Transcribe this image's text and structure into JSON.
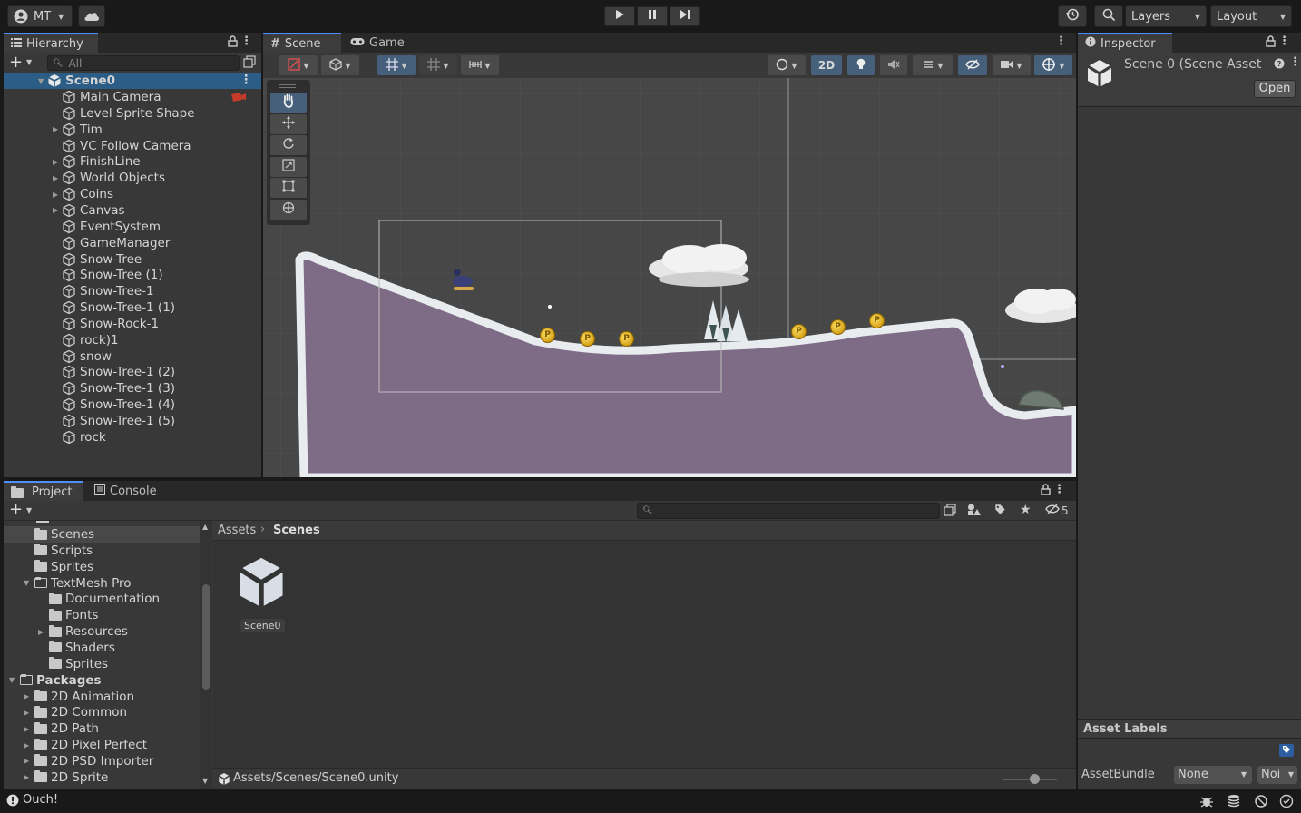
{
  "toolbar": {
    "account_label": "MT",
    "layers_label": "Layers",
    "layout_label": "Layout"
  },
  "hierarchy": {
    "tab_label": "Hierarchy",
    "search_placeholder": "All",
    "scene_name": "Scene0",
    "items": [
      {
        "label": "Main Camera",
        "expandable": false
      },
      {
        "label": "Level Sprite Shape",
        "expandable": false
      },
      {
        "label": "Tim",
        "expandable": true
      },
      {
        "label": "VC Follow Camera",
        "expandable": false
      },
      {
        "label": "FinishLine",
        "expandable": true
      },
      {
        "label": "World Objects",
        "expandable": true
      },
      {
        "label": "Coins",
        "expandable": true
      },
      {
        "label": "Canvas",
        "expandable": true
      },
      {
        "label": "EventSystem",
        "expandable": false
      },
      {
        "label": "GameManager",
        "expandable": false
      },
      {
        "label": "Snow-Tree",
        "expandable": false
      },
      {
        "label": "Snow-Tree (1)",
        "expandable": false
      },
      {
        "label": "Snow-Tree-1",
        "expandable": false
      },
      {
        "label": "Snow-Tree-1 (1)",
        "expandable": false
      },
      {
        "label": "Snow-Rock-1",
        "expandable": false
      },
      {
        "label": "rock)1",
        "expandable": false
      },
      {
        "label": "snow",
        "expandable": false
      },
      {
        "label": "Snow-Tree-1 (2)",
        "expandable": false
      },
      {
        "label": "Snow-Tree-1 (3)",
        "expandable": false
      },
      {
        "label": "Snow-Tree-1 (4)",
        "expandable": false
      },
      {
        "label": "Snow-Tree-1 (5)",
        "expandable": false
      },
      {
        "label": "rock",
        "expandable": false
      }
    ]
  },
  "scene_view": {
    "tabs": [
      {
        "label": "Scene"
      },
      {
        "label": "Game"
      }
    ],
    "mode_2d_label": "2D"
  },
  "inspector": {
    "tab_label": "Inspector",
    "title": "Scene 0 (Scene Asset",
    "open_label": "Open",
    "asset_labels_heading": "Asset Labels",
    "assetbundle_label": "AssetBundle",
    "assetbundle_value": "None",
    "variant_value": "Noi"
  },
  "project": {
    "tabs": [
      {
        "label": "Project"
      },
      {
        "label": "Console"
      }
    ],
    "hidden_count": "5",
    "breadcrumb_root": "Assets",
    "breadcrumb_current": "Scenes",
    "tree": [
      {
        "label": "Scenes",
        "level": 1,
        "expandable": false,
        "selected": true,
        "bold": false
      },
      {
        "label": "Scripts",
        "level": 1,
        "expandable": false,
        "selected": false,
        "bold": false
      },
      {
        "label": "Sprites",
        "level": 1,
        "expandable": false,
        "selected": false,
        "bold": false
      },
      {
        "label": "TextMesh Pro",
        "level": 1,
        "expandable": true,
        "expanded": true,
        "selected": false,
        "bold": false
      },
      {
        "label": "Documentation",
        "level": 2,
        "expandable": false,
        "selected": false,
        "bold": false
      },
      {
        "label": "Fonts",
        "level": 2,
        "expandable": false,
        "selected": false,
        "bold": false
      },
      {
        "label": "Resources",
        "level": 2,
        "expandable": true,
        "selected": false,
        "bold": false
      },
      {
        "label": "Shaders",
        "level": 2,
        "expandable": false,
        "selected": false,
        "bold": false
      },
      {
        "label": "Sprites",
        "level": 2,
        "expandable": false,
        "selected": false,
        "bold": false
      },
      {
        "label": "Packages",
        "level": 0,
        "expandable": true,
        "expanded": true,
        "selected": false,
        "bold": true
      },
      {
        "label": "2D Animation",
        "level": 1,
        "expandable": true,
        "selected": false,
        "bold": false
      },
      {
        "label": "2D Common",
        "level": 1,
        "expandable": true,
        "selected": false,
        "bold": false
      },
      {
        "label": "2D Path",
        "level": 1,
        "expandable": true,
        "selected": false,
        "bold": false
      },
      {
        "label": "2D Pixel Perfect",
        "level": 1,
        "expandable": true,
        "selected": false,
        "bold": false
      },
      {
        "label": "2D PSD Importer",
        "level": 1,
        "expandable": true,
        "selected": false,
        "bold": false
      },
      {
        "label": "2D Sprite",
        "level": 1,
        "expandable": true,
        "selected": false,
        "bold": false
      }
    ],
    "asset_item_label": "Scene0",
    "footer_path": "Assets/Scenes/Scene0.unity"
  },
  "status_bar": {
    "message": "Ouch!"
  },
  "colors": {
    "accent_blue": "#4d90fe",
    "panel_bg": "#383838",
    "scene_bg": "#474747",
    "terrain_fill": "#7e6c87",
    "coin_gold": "#e6b422"
  }
}
